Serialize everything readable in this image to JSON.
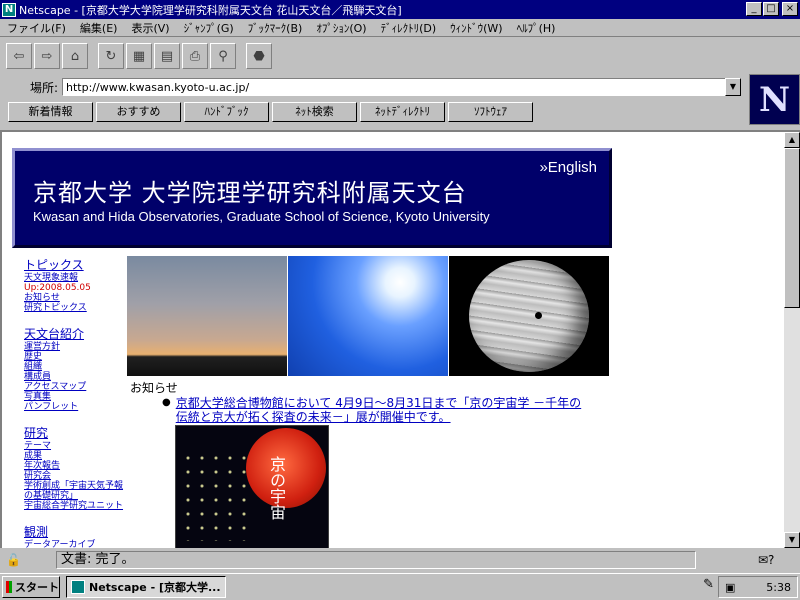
{
  "window": {
    "title": "Netscape - [京都大学大学院理学研究科附属天文台 花山天文台／飛騨天文台]",
    "app_icon": "N",
    "controls": [
      "_",
      "□",
      "×"
    ]
  },
  "menu": [
    "ファイル(F)",
    "編集(E)",
    "表示(V)",
    "ｼﾞｬﾝﾌﾟ(G)",
    "ﾌﾞｯｸﾏｰｸ(B)",
    "ｵﾌﾟｼｮﾝ(O)",
    "ﾃﾞｨﾚｸﾄﾘ(D)",
    "ｳｨﾝﾄﾞｳ(W)",
    "ﾍﾙﾌﾟ(H)"
  ],
  "toolbar": {
    "icons": [
      {
        "name": "back-icon",
        "glyph": "⇦"
      },
      {
        "name": "forward-icon",
        "glyph": "⇨"
      },
      {
        "name": "home-icon",
        "glyph": "⌂"
      },
      {
        "name": "reload-icon",
        "glyph": "↻"
      },
      {
        "name": "images-icon",
        "glyph": "▦"
      },
      {
        "name": "open-icon",
        "glyph": "▤"
      },
      {
        "name": "print-icon",
        "glyph": "⎙"
      },
      {
        "name": "find-icon",
        "glyph": "⚲"
      },
      {
        "name": "stop-icon",
        "glyph": "⬣"
      }
    ]
  },
  "location": {
    "label": "場所:",
    "url": "http://www.kwasan.kyoto-u.ac.jp/"
  },
  "directory_buttons": [
    "新着情報",
    "おすすめ",
    "ﾊﾝﾄﾞﾌﾞｯｸ",
    "ﾈｯﾄ検索",
    "ﾈｯﾄﾃﾞｨﾚｸﾄﾘ",
    "ｿﾌﾄｳｪｱ"
  ],
  "logo": "N",
  "page": {
    "banner": {
      "english_link": "»English",
      "jp_title": "京都大学  大学院理学研究科附属天文台",
      "en_title": "Kwasan and Hida Observatories, Graduate School of Science, Kyoto University"
    },
    "nav": [
      {
        "head": "トピックス",
        "items": [
          "天文現象速報"
        ],
        "date": "Up:2008.05.05",
        "items2": [
          "お知らせ",
          "研究トピックス"
        ]
      },
      {
        "head": "天文台紹介",
        "items": [
          "運営方針",
          "歴史",
          "組織",
          "構成員",
          "アクセスマップ",
          "写真集",
          "パンフレット"
        ]
      },
      {
        "head": "研究",
        "items": [
          "テーマ",
          "成果",
          "年次報告",
          "研究会",
          "学術創成「宇宙天気予報の基礎研究」",
          "宇宙総合学研究ユニット"
        ]
      },
      {
        "head": "観測",
        "items": [
          "データアーカイブ"
        ]
      }
    ],
    "notice_label": "お知らせ",
    "news_item": "京都大学総合博物館において 4月9日～8月31日まで「京の宇宙学 －千年の伝統と京大が拓く探査の未来－」展が開催中です。",
    "poster_title": "京の宇宙"
  },
  "status": {
    "text": "文書: 完了。",
    "icon": "🔓"
  },
  "taskbar": {
    "start_label": "スタート",
    "task_label": "Netscape - [京都大学...",
    "clock": "5:38"
  }
}
